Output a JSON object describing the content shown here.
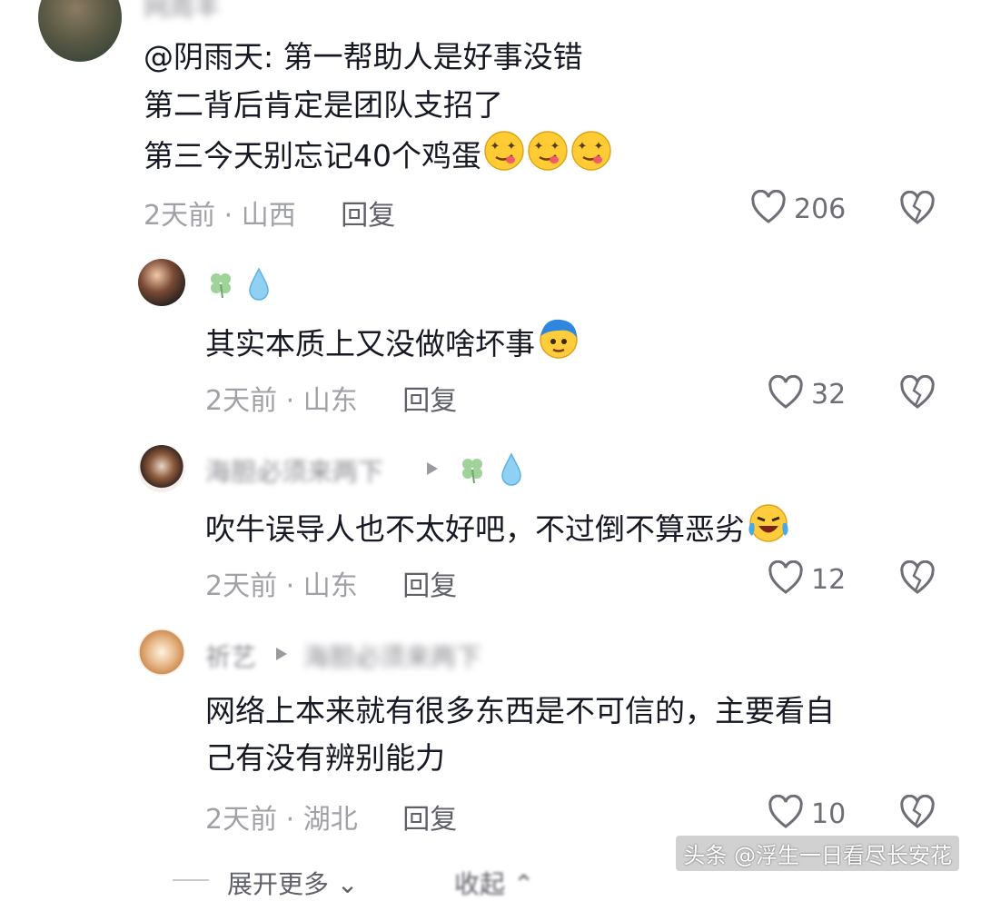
{
  "main_comment": {
    "username": "网周丰",
    "lines": [
      "@阴雨天: 第一帮助人是好事没错",
      "第二背后肯定是团队支招了",
      "第三今天别忘记40个鸡蛋"
    ],
    "time": "2天前",
    "location": "山西",
    "reply_label": "回复",
    "likes": "206"
  },
  "replies": [
    {
      "username": "",
      "badges": [
        "clover-icon",
        "droplet-icon"
      ],
      "text": "其实本质上又没做啥坏事",
      "time": "2天前",
      "location": "山东",
      "reply_label": "回复",
      "likes": "32"
    },
    {
      "username": "海胆必须来两下",
      "badges": [
        "clover-icon",
        "droplet-icon"
      ],
      "text": "吹牛误导人也不太好吧，不过倒不算恶劣",
      "time": "2天前",
      "location": "山东",
      "reply_label": "回复",
      "likes": "12"
    },
    {
      "username": "祈艺",
      "reply_to": "海胆必须来两下",
      "text_lines": [
        "网络上本来就有很多东西是不可信的，主要看自",
        "己有没有辨别能力"
      ],
      "time": "2天前",
      "location": "湖北",
      "reply_label": "回复",
      "likes": "10"
    }
  ],
  "footer": {
    "expand_label": "展开更多",
    "collapse_label": "收起"
  },
  "watermark": "头条 @浮生一日看尽长安花",
  "colors": {
    "text": "#161823",
    "meta": "#a0a1a7",
    "like_count": "#6e6f76"
  }
}
